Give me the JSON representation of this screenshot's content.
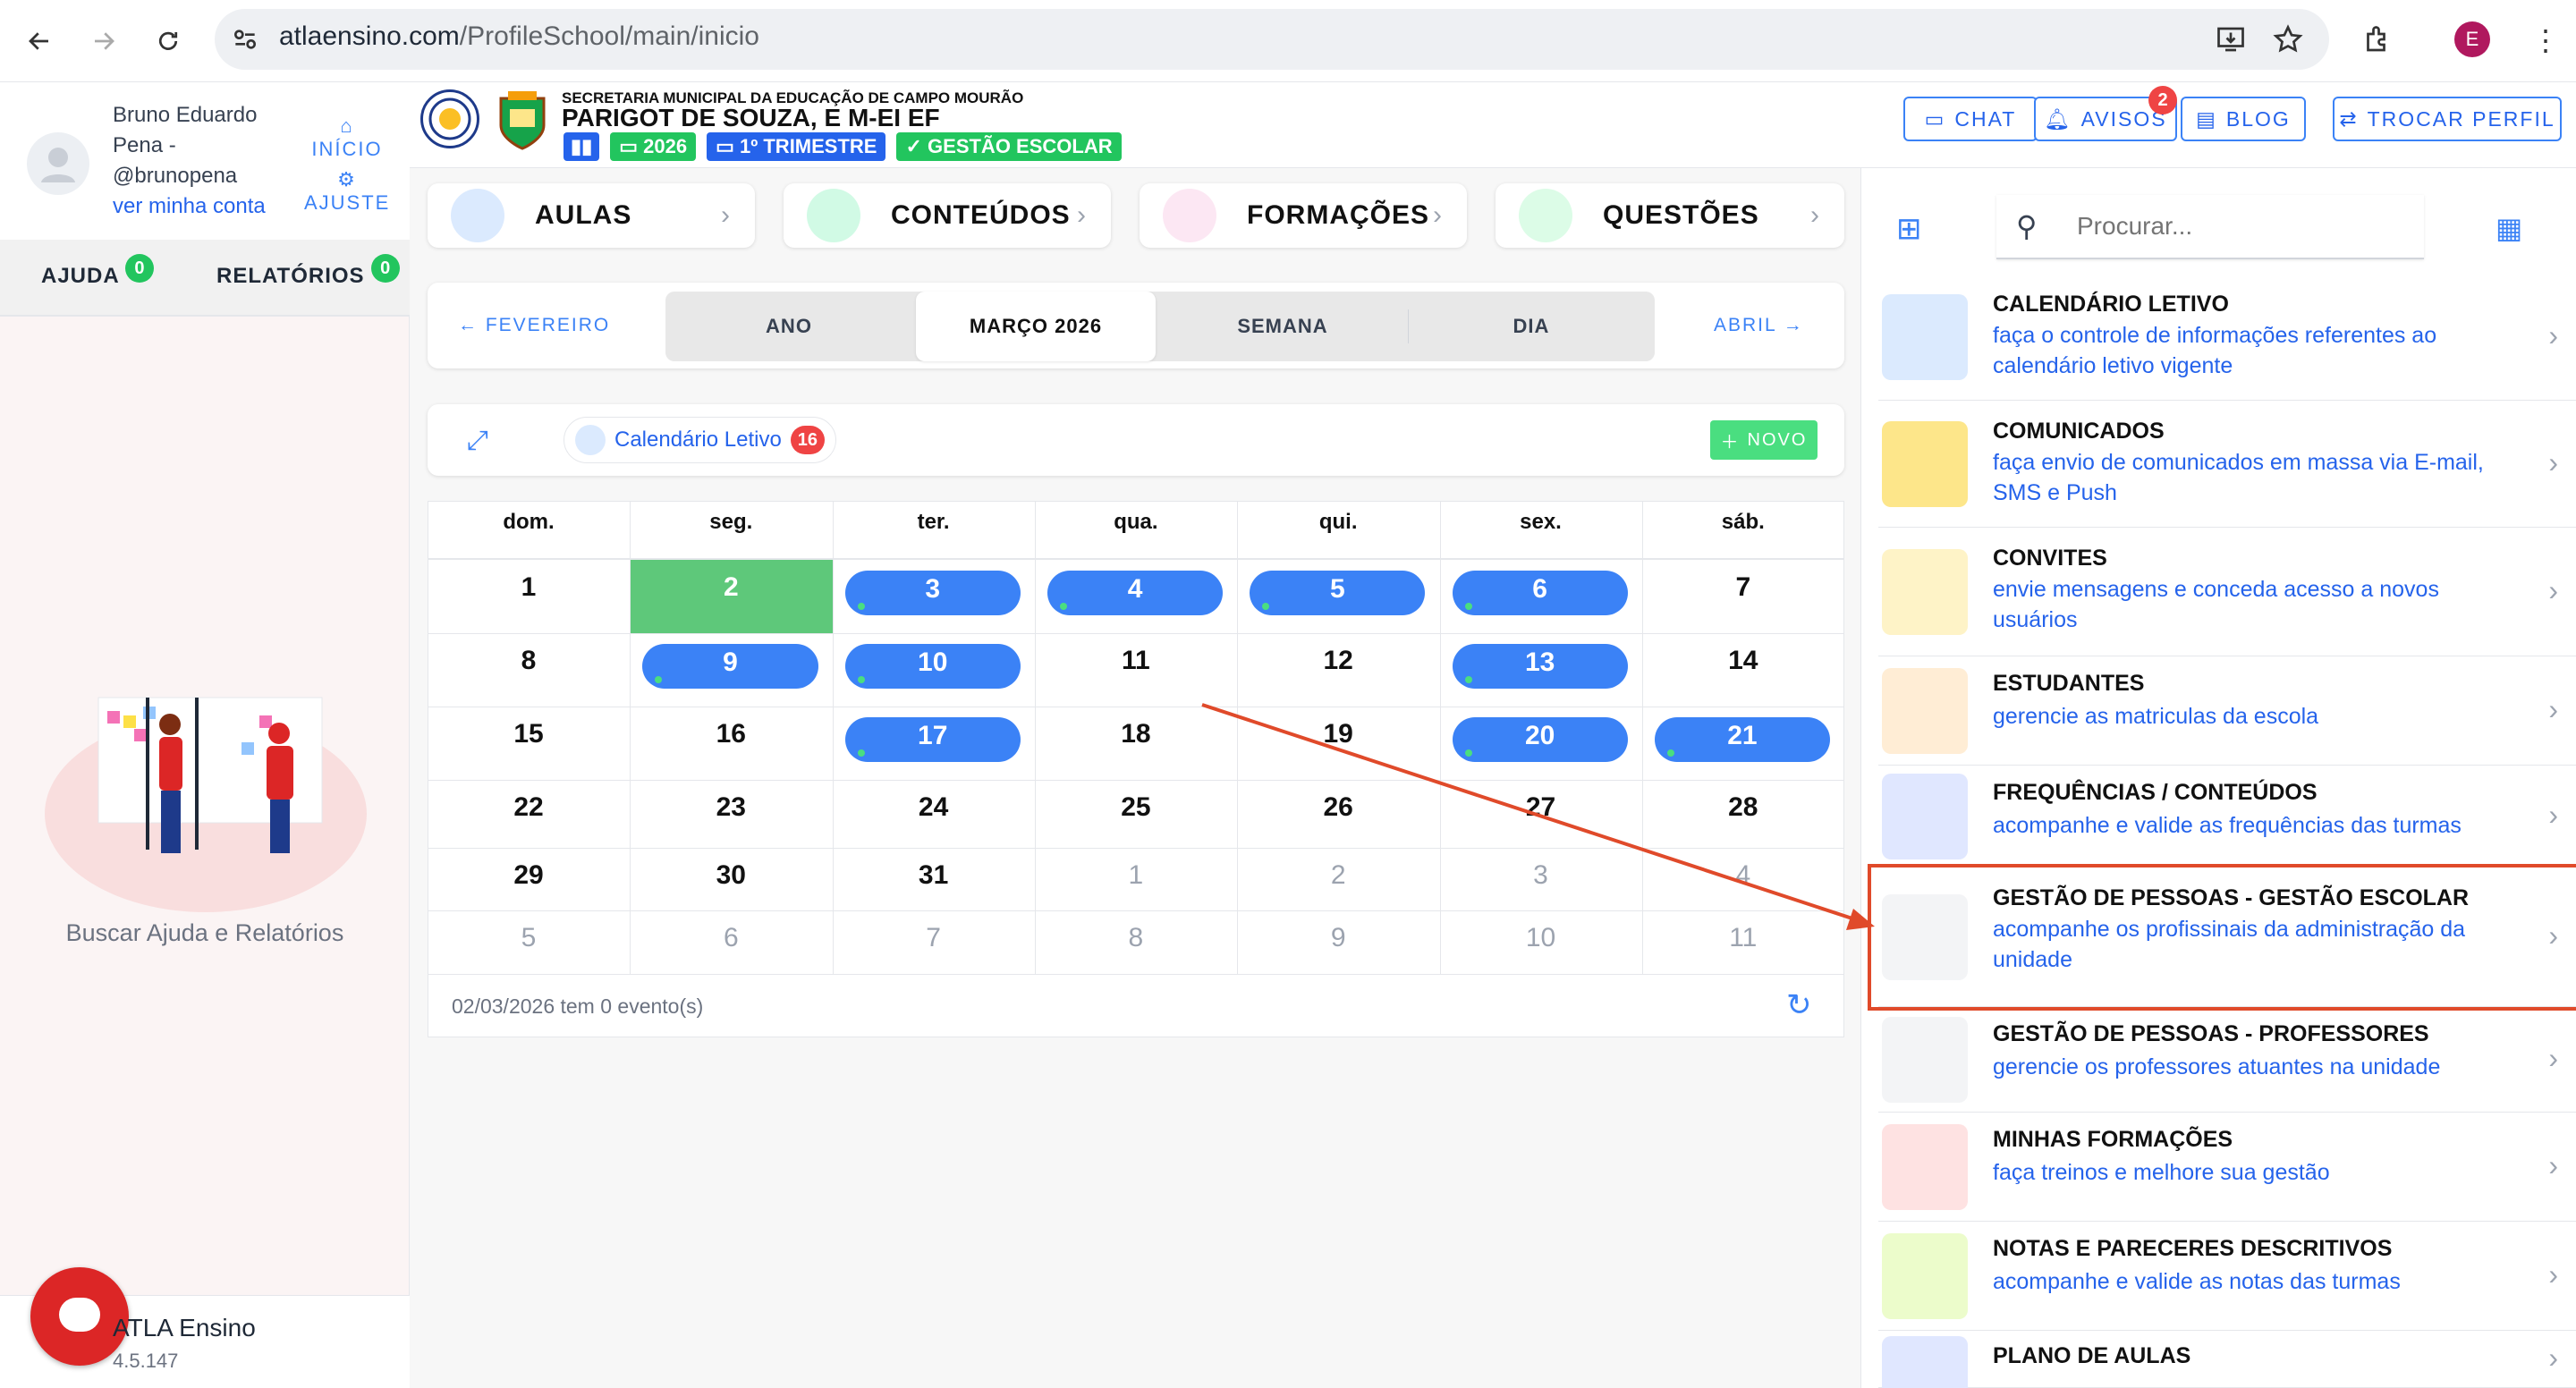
{
  "browser": {
    "url_host": "atlaensino.com",
    "url_path": "/ProfileSchool/main/inicio",
    "profile_initial": "E"
  },
  "user": {
    "name_line1": "Bruno Eduardo",
    "name_line2": "Pena -",
    "handle": "@brunopena",
    "link": "ver minha conta",
    "inicio": "INÍCIO",
    "ajuste": "AJUSTE"
  },
  "left_tabs": {
    "ajuda": "AJUDA",
    "ajuda_count": "0",
    "relatorios": "RELATÓRIOS",
    "relatorios_count": "0"
  },
  "left_empty": {
    "caption": "Buscar Ajuda e Relatórios"
  },
  "footer": {
    "app_name": "ATLA Ensino",
    "version": "4.5.147"
  },
  "school": {
    "secretaria": "SECRETARIA MUNICIPAL DA EDUCAÇÃO DE CAMPO MOURÃO",
    "name": "PARIGOT DE SOUZA, E M-EI EF",
    "year": "2026",
    "period": "1º TRIMESTRE",
    "role": "GESTÃO ESCOLAR"
  },
  "header_buttons": {
    "chat": "CHAT",
    "avisos": "AVISOS",
    "avisos_count": "2",
    "blog": "BLOG",
    "trocar": "TROCAR PERFIL"
  },
  "nav_cards": [
    {
      "label": "AULAS"
    },
    {
      "label": "CONTEÚDOS"
    },
    {
      "label": "FORMAÇÕES"
    },
    {
      "label": "QUESTÕES"
    }
  ],
  "view": {
    "prev": "FEVEREIRO",
    "next": "ABRIL",
    "segments": [
      "ANO",
      "MARÇO 2026",
      "SEMANA",
      "DIA"
    ],
    "active": "MARÇO 2026"
  },
  "calendar_bar": {
    "filter_label": "Calendário Letivo",
    "filter_count": "16",
    "new_button": "NOVO"
  },
  "calendar": {
    "weekdays": [
      "dom.",
      "seg.",
      "ter.",
      "qua.",
      "qui.",
      "sex.",
      "sáb."
    ],
    "weeks": [
      [
        "1",
        "2",
        "3",
        "4",
        "5",
        "6",
        "7"
      ],
      [
        "8",
        "9",
        "10",
        "11",
        "12",
        "13",
        "14"
      ],
      [
        "15",
        "16",
        "17",
        "18",
        "19",
        "20",
        "21"
      ],
      [
        "22",
        "23",
        "24",
        "25",
        "26",
        "27",
        "28"
      ],
      [
        "29",
        "30",
        "31",
        "1",
        "2",
        "3",
        "4"
      ],
      [
        "5",
        "6",
        "7",
        "8",
        "9",
        "10",
        "11"
      ]
    ],
    "selected_day": "2",
    "event_days": [
      "3",
      "4",
      "5",
      "6",
      "9",
      "10",
      "13",
      "17",
      "20",
      "21"
    ],
    "status": "02/03/2026 tem 0 evento(s)"
  },
  "right_panel": {
    "search_placeholder": "Procurar...",
    "items": [
      {
        "title": "CALENDÁRIO LETIVO",
        "desc": "faça o controle de informações referentes ao calendário letivo vigente"
      },
      {
        "title": "COMUNICADOS",
        "desc": "faça envio de comunicados em massa via E-mail, SMS e Push"
      },
      {
        "title": "CONVITES",
        "desc": "envie mensagens e conceda acesso a novos usuários"
      },
      {
        "title": "ESTUDANTES",
        "desc": "gerencie as matriculas da escola"
      },
      {
        "title": "FREQUÊNCIAS / CONTEÚDOS",
        "desc": "acompanhe e valide as frequências das turmas"
      },
      {
        "title": "GESTÃO DE PESSOAS - GESTÃO ESCOLAR",
        "desc": "acompanhe os profissinais da administração da unidade"
      },
      {
        "title": "GESTÃO DE PESSOAS - PROFESSORES",
        "desc": "gerencie os professores atuantes na unidade"
      },
      {
        "title": "MINHAS FORMAÇÕES",
        "desc": "faça treinos e melhore sua gestão"
      },
      {
        "title": "NOTAS E PARECERES DESCRITIVOS",
        "desc": "acompanhe e valide as notas das turmas"
      },
      {
        "title": "PLANO DE AULAS",
        "desc": ""
      }
    ]
  },
  "colors": {
    "primary": "#3b82f6",
    "green": "#4ade80",
    "red": "#ef4444",
    "highlight": "#e04a2a"
  }
}
